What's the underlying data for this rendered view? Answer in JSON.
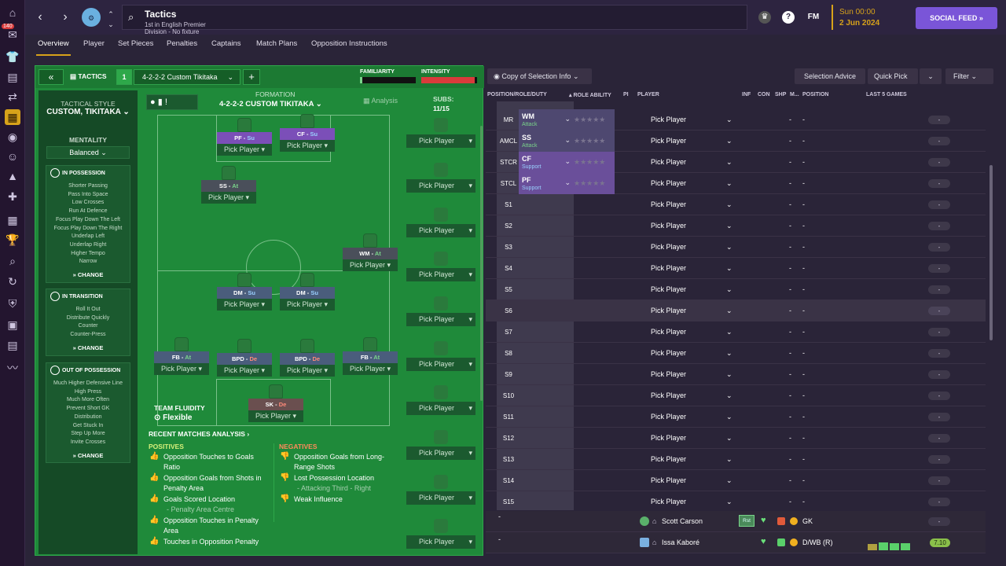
{
  "nav_badge": "140",
  "header": {
    "title": "Tactics",
    "subtitle": "1st in English Premier Division - No fixture scheduled.",
    "fm_label": "FM",
    "help_label": "?",
    "date_time": "Sun 00:00",
    "date": "2 Jun 2024",
    "social_feed": "SOCIAL FEED"
  },
  "tabs": [
    "Overview",
    "Player",
    "Set Pieces",
    "Penalties",
    "Captains",
    "Match Plans",
    "Opposition Instructions"
  ],
  "tactic_bar": {
    "tactics_label": "TACTICS",
    "slot_number": "1",
    "tactic_name": "4-2-2-2 Custom Tikitaka",
    "add_label": "+",
    "familiarity_label": "FAMILIARITY",
    "intensity_label": "INTENSITY"
  },
  "tactical_style": {
    "heading": "TACTICAL STYLE",
    "value": "CUSTOM, TIKITAKA",
    "mentality_label": "MENTALITY",
    "mentality": "Balanced",
    "in_possession": {
      "title": "IN POSSESSION",
      "items": [
        "Shorter Passing",
        "Pass Into Space",
        "Low Crosses",
        "Run At Defence",
        "Focus Play Down The Left",
        "Focus Play Down The Right",
        "Underlap Left",
        "Underlap Right",
        "Higher Tempo",
        "Narrow"
      ],
      "change": "CHANGE"
    },
    "in_transition": {
      "title": "IN TRANSITION",
      "items": [
        "Roll It Out",
        "Distribute Quickly",
        "Counter",
        "Counter-Press"
      ],
      "change": "CHANGE"
    },
    "out_of_possession": {
      "title": "OUT OF POSSESSION",
      "items": [
        "Much Higher Defensive Line",
        "High Press",
        "Much More Often",
        "Prevent Short GK",
        "Distribution",
        "Get Stuck In",
        "Step Up More",
        "Invite Crosses"
      ],
      "change": "CHANGE"
    }
  },
  "formation": {
    "label": "FORMATION",
    "name": "4-2-2-2 CUSTOM TIKITAKA",
    "analysis": "Analysis",
    "subs_label": "SUBS:",
    "subs_count": "11/15",
    "pick_label": "Pick Player",
    "team_fluidity_label": "TEAM FLUIDITY",
    "team_fluidity": "Flexible"
  },
  "slots": [
    {
      "role": "PF",
      "duty": "Su"
    },
    {
      "role": "CF",
      "duty": "Su"
    },
    {
      "role": "SS",
      "duty": "At"
    },
    {
      "role": "WM",
      "duty": "At"
    },
    {
      "role": "DM",
      "duty": "Su"
    },
    {
      "role": "DM",
      "duty": "Su"
    },
    {
      "role": "FB",
      "duty": "At"
    },
    {
      "role": "BPD",
      "duty": "De"
    },
    {
      "role": "BPD",
      "duty": "De"
    },
    {
      "role": "FB",
      "duty": "At"
    },
    {
      "role": "SK",
      "duty": "De"
    }
  ],
  "analysis": {
    "title": "RECENT MATCHES ANALYSIS",
    "positives_label": "POSITIVES",
    "negatives_label": "NEGATIVES",
    "positives": [
      {
        "text": "Opposition Touches to Goals Ratio",
        "sub": ""
      },
      {
        "text": "Opposition Goals from Shots in Penalty Area",
        "sub": ""
      },
      {
        "text": "Goals Scored Location",
        "sub": "- Penalty Area Centre"
      },
      {
        "text": "Opposition Touches in Penalty Area",
        "sub": ""
      },
      {
        "text": "Touches in Opposition Penalty",
        "sub": ""
      }
    ],
    "negatives": [
      {
        "text": "Opposition Goals from Long-Range Shots",
        "sub": ""
      },
      {
        "text": "Lost Possession Location",
        "sub": "- Attacking Third - Right"
      },
      {
        "text": "Weak Influence",
        "sub": ""
      }
    ]
  },
  "right": {
    "copy_info": "Copy of Selection Info",
    "selection_advice": "Selection Advice",
    "quick_pick": "Quick Pick",
    "filter": "Filter",
    "headers": [
      "POSITION/ROLE/DUTY",
      "ROLE ABILITY",
      "PI",
      "PLAYER",
      "INF",
      "CON",
      "SHP",
      "M...",
      "POSITION",
      "LAST 5 GAMES"
    ],
    "rows": [
      {
        "pos": "MR",
        "role": "WM",
        "duty": "Attack"
      },
      {
        "pos": "AMCL",
        "role": "SS",
        "duty": "Attack"
      },
      {
        "pos": "STCR",
        "role": "CF",
        "duty": "Support"
      },
      {
        "pos": "STCL",
        "role": "PF",
        "duty": "Support"
      },
      {
        "pos": "S1"
      },
      {
        "pos": "S2"
      },
      {
        "pos": "S3"
      },
      {
        "pos": "S4"
      },
      {
        "pos": "S5"
      },
      {
        "pos": "S6"
      },
      {
        "pos": "S7"
      },
      {
        "pos": "S8"
      },
      {
        "pos": "S9"
      },
      {
        "pos": "S10"
      },
      {
        "pos": "S11"
      },
      {
        "pos": "S12"
      },
      {
        "pos": "S13"
      },
      {
        "pos": "S14"
      },
      {
        "pos": "S15"
      }
    ],
    "pick_label": "Pick Player",
    "dash": "-",
    "players": [
      {
        "name": "Scott Carson",
        "tag": "Rst",
        "position": "GK",
        "rating": "-"
      },
      {
        "name": "Issa Kaboré",
        "position": "D/WB (R)",
        "rating": "7.10"
      }
    ]
  }
}
